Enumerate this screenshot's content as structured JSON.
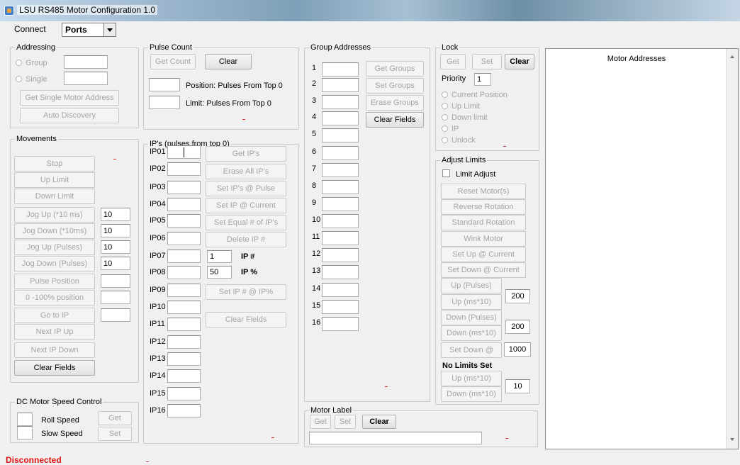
{
  "window": {
    "title": "LSU RS485 Motor Configuration 1.0"
  },
  "connect": {
    "label": "Connect",
    "selected": "Ports"
  },
  "addressing": {
    "title": "Addressing",
    "group_label": "Group",
    "single_label": "Single",
    "get_single_btn": "Get Single Motor Address",
    "auto_discovery_btn": "Auto Discovery"
  },
  "movements": {
    "title": "Movements",
    "buttons": [
      "Stop",
      "Up Limit",
      "Down Limit",
      "Jog Up (*10 ms)",
      "Jog Down (*10ms)",
      "Jog Up (Pulses)",
      "Jog Down (Pulses)",
      "Pulse Position",
      "0 -100% position",
      "Go to IP",
      "Next IP Up",
      "Next IP Down",
      "Clear Fields"
    ],
    "values": [
      "10",
      "10",
      "10",
      "10"
    ]
  },
  "dc_speed": {
    "title": "DC Motor Speed Control",
    "roll_label": "Roll Speed",
    "slow_label": "Slow Speed",
    "get_btn": "Get",
    "set_btn": "Set"
  },
  "pulse_count": {
    "title": "Pulse Count",
    "get_count_btn": "Get Count",
    "clear_btn": "Clear",
    "position_label": "Position: Pulses From Top 0",
    "limit_label": "Limit: Pulses From Top 0"
  },
  "ips": {
    "title": "IP's (pulses from top 0)",
    "labels": [
      "IP01",
      "IP02",
      "IP03",
      "IP04",
      "IP05",
      "IP06",
      "IP07",
      "IP08",
      "IP09",
      "IP10",
      "IP11",
      "IP12",
      "IP13",
      "IP14",
      "IP15",
      "IP16"
    ],
    "buttons": [
      "Get IP's",
      "Erase All IP's",
      "Set IP's @ Pulse",
      "Set IP @ Current",
      "Set Equal # of IP's",
      "Delete IP #"
    ],
    "ip_num_value": "1",
    "ip_num_label": "IP #",
    "ip_pct_value": "50",
    "ip_pct_label": "IP %",
    "set_ip_btn": "Set IP # @ IP%",
    "clear_btn": "Clear Fields"
  },
  "group_addresses": {
    "title": "Group Addresses",
    "labels": [
      "1",
      "2",
      "3",
      "4",
      "5",
      "6",
      "7",
      "8",
      "9",
      "10",
      "11",
      "12",
      "13",
      "14",
      "15",
      "16"
    ],
    "buttons": [
      "Get Groups",
      "Set Groups",
      "Erase Groups",
      "Clear Fields"
    ]
  },
  "lock": {
    "title": "Lock",
    "get_btn": "Get",
    "set_btn": "Set",
    "clear_btn": "Clear",
    "priority_label": "Priority",
    "priority_value": "1",
    "options": [
      "Current Position",
      "Up Limit",
      "Down limit",
      "IP",
      "Unlock"
    ]
  },
  "adjust_limits": {
    "title": "Adjust Limits",
    "limit_adjust_label": "Limit Adjust",
    "buttons": [
      "Reset Motor(s)",
      "Reverse Rotation",
      "Standard Rotation",
      "Wink Motor",
      "Set Up @ Current",
      "Set Down @ Current"
    ],
    "up_pulses_btn": "Up (Pulses)",
    "up_ms_btn": "Up (ms*10)",
    "up_value": "200",
    "down_pulses_btn": "Down (Pulses)",
    "down_ms_btn": "Down (ms*10)",
    "down_value": "200",
    "set_down_btn": "Set Down @",
    "set_down_value": "1000",
    "no_limits_label": "No Limits Set",
    "nl_up_btn": "Up (ms*10)",
    "nl_down_btn": "Down (ms*10)",
    "nl_value": "10"
  },
  "motor_label": {
    "title": "Motor Label",
    "get_btn": "Get",
    "set_btn": "Set",
    "clear_btn": "Clear"
  },
  "motor_addresses": {
    "title": "Motor Addresses"
  },
  "status": {
    "text": "Disconnected"
  }
}
